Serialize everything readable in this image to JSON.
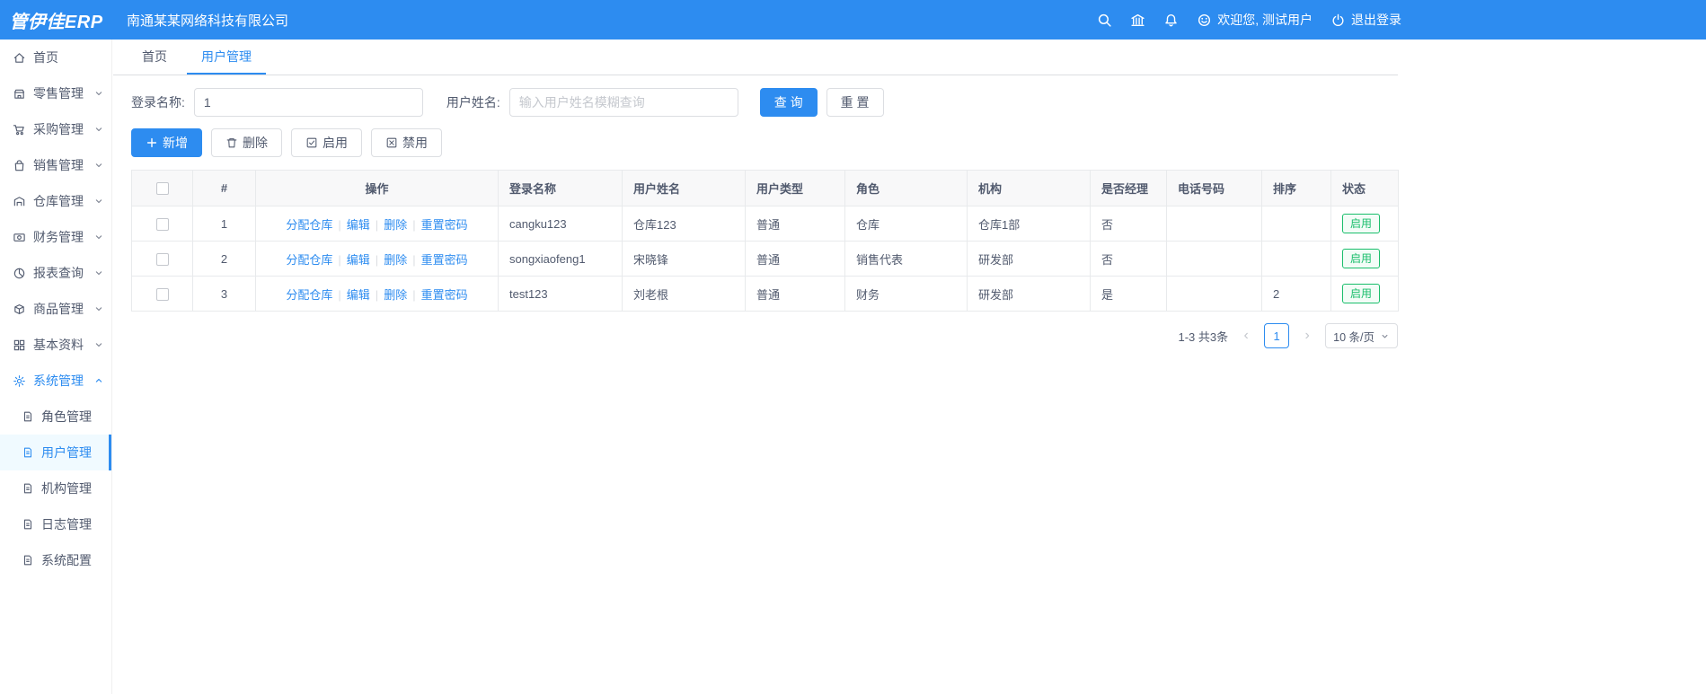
{
  "topbar": {
    "logo": "管伊佳ERP",
    "company": "南通某某网络科技有限公司",
    "welcome": "欢迎您, 测试用户",
    "logout": "退出登录",
    "brand_color": "#2d8cf0"
  },
  "sidebar": {
    "items": [
      {
        "label": "首页"
      },
      {
        "label": "零售管理"
      },
      {
        "label": "采购管理"
      },
      {
        "label": "销售管理"
      },
      {
        "label": "仓库管理"
      },
      {
        "label": "财务管理"
      },
      {
        "label": "报表查询"
      },
      {
        "label": "商品管理"
      },
      {
        "label": "基本资料"
      },
      {
        "label": "系统管理"
      }
    ],
    "system_children": [
      {
        "label": "角色管理"
      },
      {
        "label": "用户管理"
      },
      {
        "label": "机构管理"
      },
      {
        "label": "日志管理"
      },
      {
        "label": "系统配置"
      }
    ]
  },
  "tabs": [
    {
      "label": "首页"
    },
    {
      "label": "用户管理"
    }
  ],
  "search": {
    "login_label": "登录名称:",
    "login_value": "1",
    "name_label": "用户姓名:",
    "name_placeholder": "输入用户姓名模糊查询",
    "query_label": "查 询",
    "reset_label": "重 置"
  },
  "toolbar": {
    "add": "新增",
    "delete": "删除",
    "enable": "启用",
    "disable": "禁用"
  },
  "table": {
    "headers": [
      "#",
      "操作",
      "登录名称",
      "用户姓名",
      "用户类型",
      "角色",
      "机构",
      "是否经理",
      "电话号码",
      "排序",
      "状态"
    ],
    "action_links": [
      "分配仓库",
      "编辑",
      "删除",
      "重置密码"
    ],
    "rows": [
      {
        "index": "1",
        "login": "cangku123",
        "name": "仓库123",
        "type": "普通",
        "role": "仓库",
        "org": "仓库1部",
        "manager": "否",
        "phone": "",
        "sort": "",
        "status": "启用"
      },
      {
        "index": "2",
        "login": "songxiaofeng1",
        "name": "宋晓锋",
        "type": "普通",
        "role": "销售代表",
        "org": "研发部",
        "manager": "否",
        "phone": "",
        "sort": "",
        "status": "启用"
      },
      {
        "index": "3",
        "login": "test123",
        "name": "刘老根",
        "type": "普通",
        "role": "财务",
        "org": "研发部",
        "manager": "是",
        "phone": "",
        "sort": "2",
        "status": "启用"
      }
    ],
    "status_color": "#19be6b"
  },
  "pagination": {
    "total_text": "1-3 共3条",
    "current_page": "1",
    "page_size": "10 条/页"
  }
}
